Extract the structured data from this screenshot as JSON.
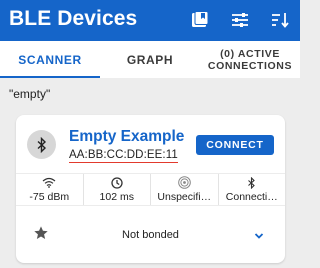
{
  "appbar": {
    "title": "BLE Devices",
    "bg_color": "#1565c9",
    "actions": [
      "bookmark-icon",
      "tune-sliders-icon",
      "sort-icon"
    ]
  },
  "tabs": [
    {
      "label": "SCANNER",
      "active": true
    },
    {
      "label": "GRAPH",
      "active": false
    },
    {
      "label_line1": "(0) ACTIVE",
      "label_line2": "CONNECTIONS",
      "active": false
    }
  ],
  "filter_text": "\"empty\"",
  "device": {
    "name": "Empty Example",
    "address": "AA:BB:CC:DD:EE:11",
    "connect_label": "CONNECT",
    "stats": [
      {
        "icon": "signal-wifi-icon",
        "value": "-75 dBm"
      },
      {
        "icon": "clock-icon",
        "value": "102 ms"
      },
      {
        "icon": "broadcast-icon",
        "value": "Unspecifi…"
      },
      {
        "icon": "bluetooth-icon",
        "value": "Connecti…"
      }
    ],
    "bond_status": "Not bonded",
    "accent_color": "#1565c9",
    "address_underline_color": "#e23a2d"
  }
}
